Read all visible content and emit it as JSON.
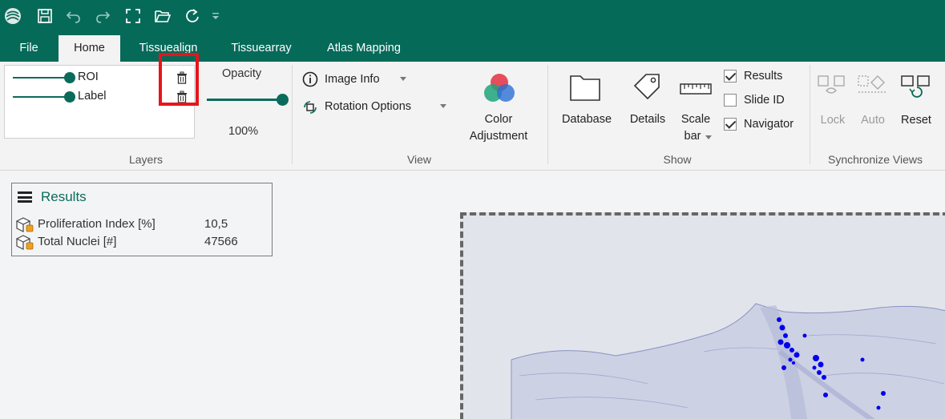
{
  "quick_access": {
    "icons": [
      "app-logo-icon",
      "save-icon",
      "undo-icon",
      "redo-icon",
      "fullscreen-icon",
      "open-folder-icon",
      "refresh-icon",
      "customize-dropdown-icon"
    ]
  },
  "tabs": [
    {
      "label": "File",
      "active": false
    },
    {
      "label": "Home",
      "active": true
    },
    {
      "label": "Tissuealign",
      "active": false
    },
    {
      "label": "Tissuearray",
      "active": false
    },
    {
      "label": "Atlas Mapping",
      "active": false
    }
  ],
  "layers_group": {
    "label": "Layers",
    "items": [
      {
        "label": "ROI"
      },
      {
        "label": "Label"
      }
    ],
    "opacity_title": "Opacity",
    "opacity_value": "100%",
    "opacity_level": 1.0
  },
  "view_group": {
    "label": "View",
    "image_info": "Image Info",
    "rotation_options": "Rotation Options",
    "color_adjustment_line1": "Color",
    "color_adjustment_line2": "Adjustment"
  },
  "show_group": {
    "label": "Show",
    "database": "Database",
    "details": "Details",
    "scale_line1": "Scale",
    "scale_line2": "bar",
    "checks": [
      {
        "label": "Results",
        "checked": true
      },
      {
        "label": "Slide ID",
        "checked": false
      },
      {
        "label": "Navigator",
        "checked": true
      }
    ]
  },
  "sync_group": {
    "label": "Synchronize Views",
    "lock": "Lock",
    "auto": "Auto",
    "reset": "Reset"
  },
  "results_panel": {
    "title": "Results",
    "rows": [
      {
        "label": "Proliferation Index [%]",
        "value": "10,5"
      },
      {
        "label": "Total Nuclei [#]",
        "value": "47566"
      }
    ]
  },
  "colors": {
    "brand": "#066a59",
    "accent": "#0b6b5a",
    "highlight": "#e8141b",
    "nuclei": "#0000ee"
  }
}
